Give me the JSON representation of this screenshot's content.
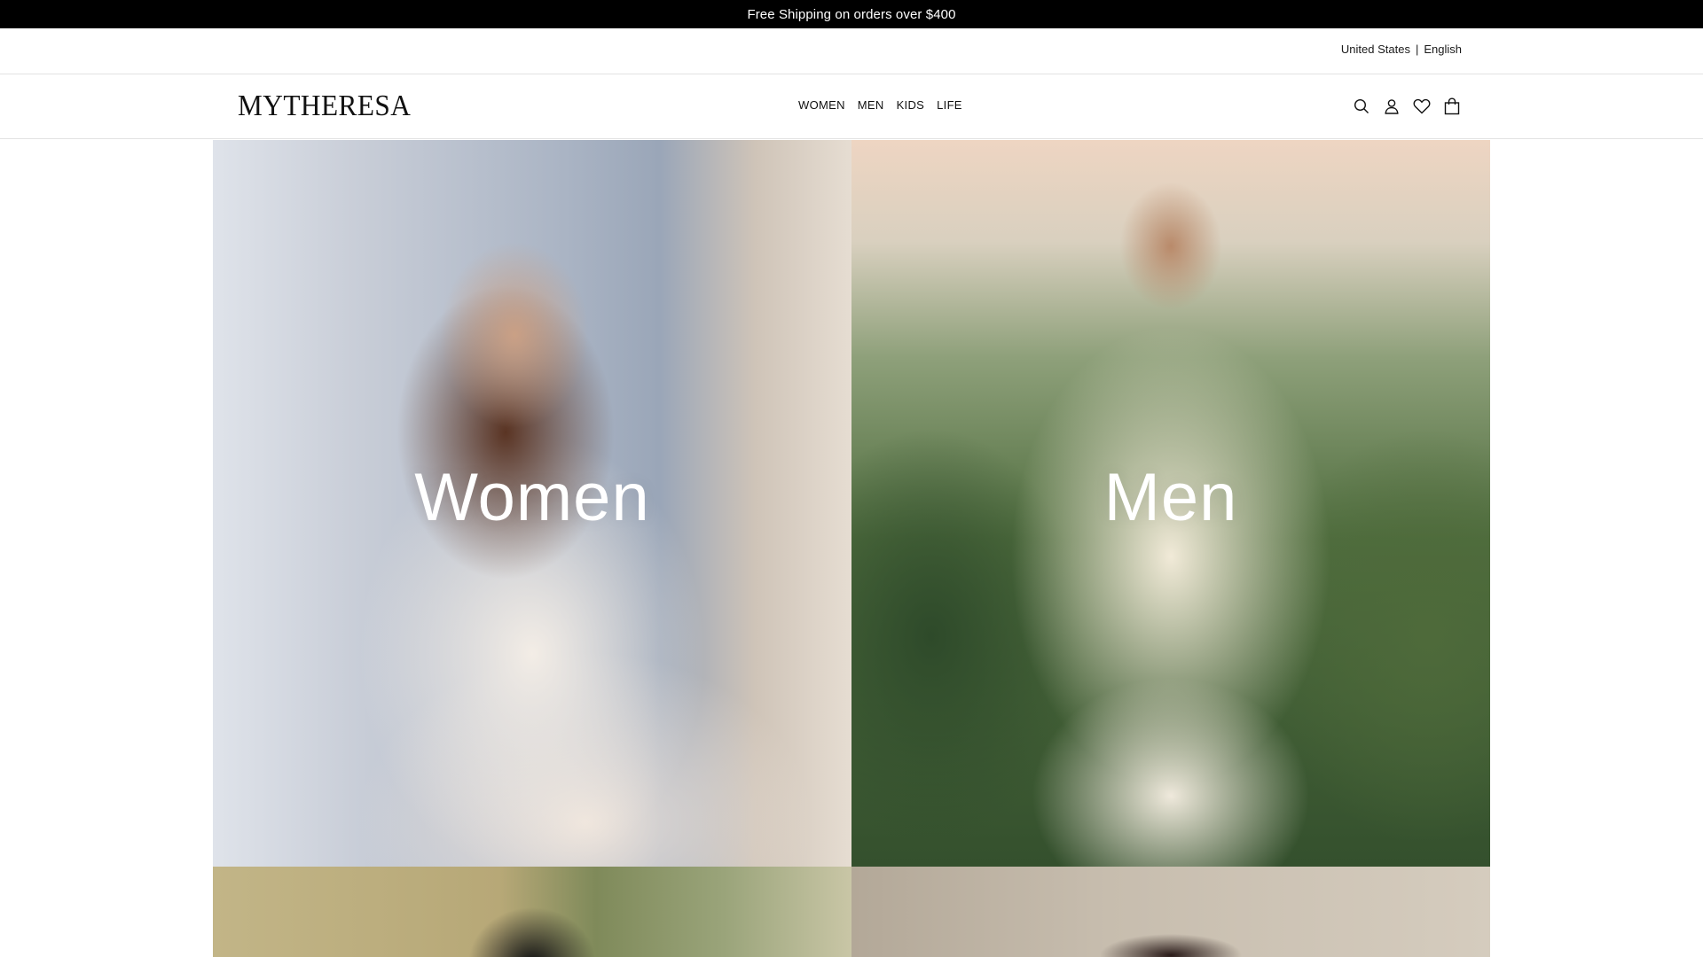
{
  "promo": {
    "text": "Free Shipping on orders over $400"
  },
  "locale": {
    "country": "United States",
    "separator": "|",
    "language": "English"
  },
  "header": {
    "logo": "MYTHERESA",
    "nav": [
      {
        "label": "WOMEN"
      },
      {
        "label": "MEN"
      },
      {
        "label": "KIDS"
      },
      {
        "label": "LIFE"
      }
    ],
    "icons": [
      "search-icon",
      "account-icon",
      "wishlist-heart-icon",
      "shopping-bag-icon"
    ]
  },
  "tiles": [
    {
      "title": "Women"
    },
    {
      "title": "Men"
    }
  ],
  "colors": {
    "promo_bg": "#000000",
    "promo_text": "#ffffff",
    "divider": "#e2e2e2"
  }
}
